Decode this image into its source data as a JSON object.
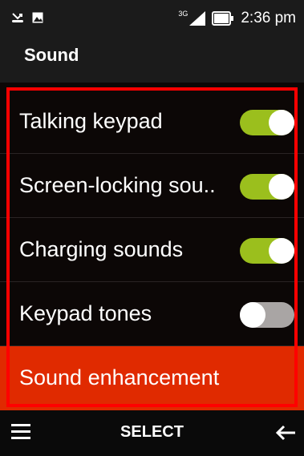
{
  "status_bar": {
    "left_icons": [
      "missed-call-icon",
      "image-icon"
    ],
    "network_type": "3G",
    "time": "2:36 pm"
  },
  "app_bar": {
    "title": "Sound"
  },
  "settings": {
    "items": [
      {
        "label": "Talking keypad",
        "toggle": "on"
      },
      {
        "label": "Screen-locking sou..",
        "toggle": "on"
      },
      {
        "label": "Charging sounds",
        "toggle": "on"
      },
      {
        "label": "Keypad tones",
        "toggle": "off"
      },
      {
        "label": "Sound enhancement",
        "selected": true
      }
    ]
  },
  "softkeys": {
    "left_icon": "menu-icon",
    "center_label": "SELECT",
    "right_icon": "back-arrow-icon"
  },
  "colors": {
    "toggle_on": "#9bbf1d",
    "toggle_off": "#a9a5a4",
    "selected_row": "#e02a00",
    "highlight_frame": "#ff0000"
  }
}
